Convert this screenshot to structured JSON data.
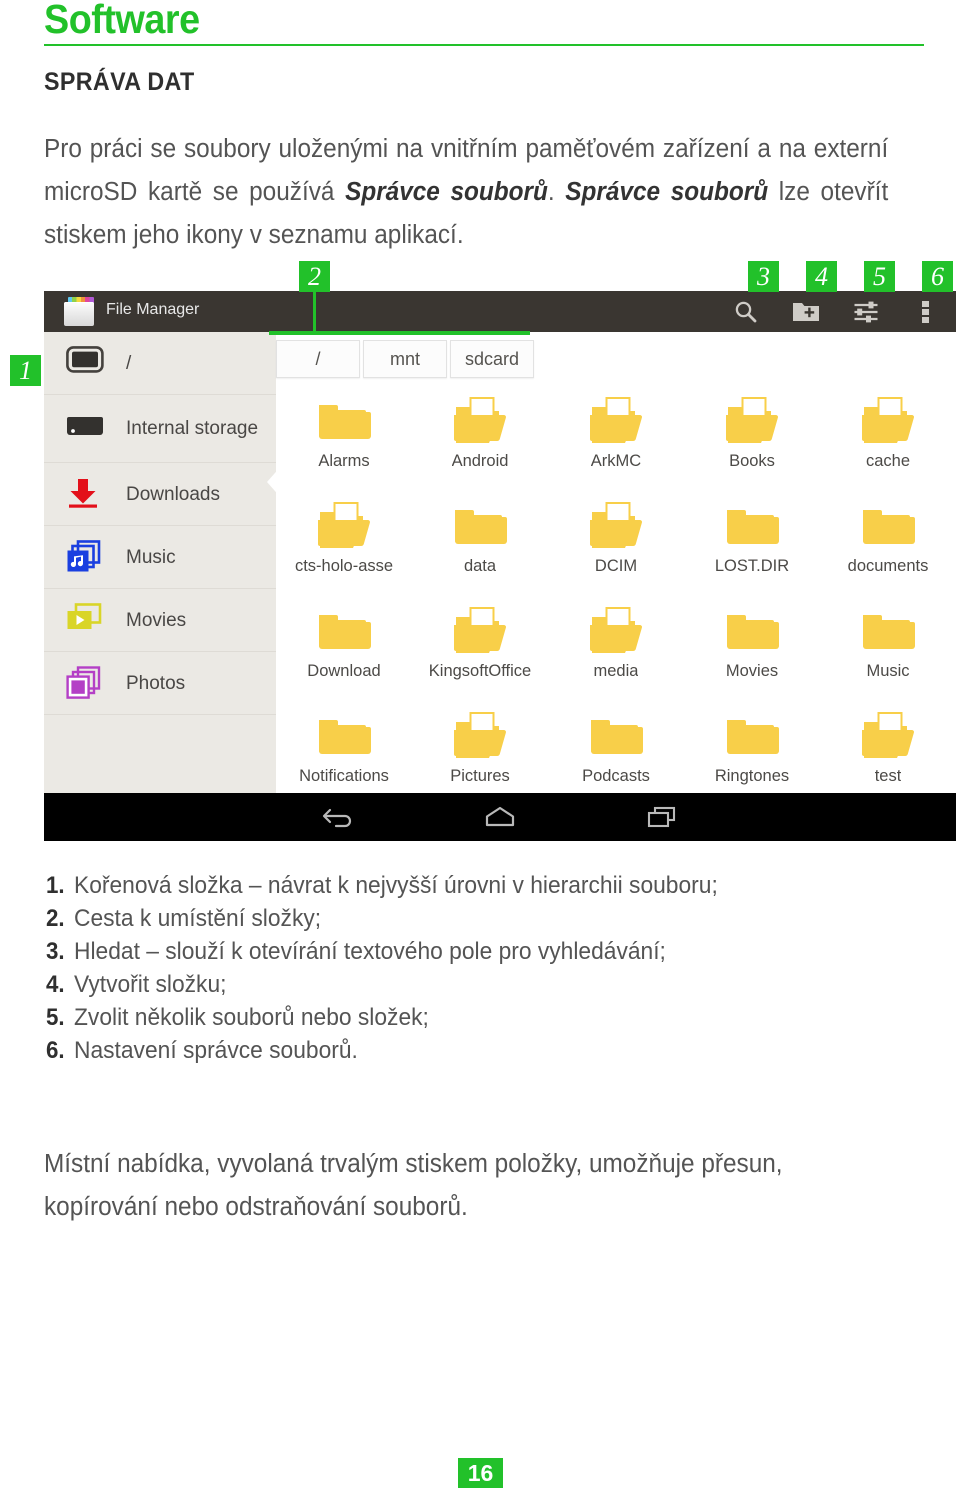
{
  "page": {
    "heading": "Software",
    "section_title": "SPRÁVA DAT",
    "intro_part1": "Pro práci se soubory uloženými na vnitřním paměťovém zařízení a na externí microSD kartě se používá ",
    "intro_italic1": "Správce souborů",
    "intro_part2": ". ",
    "intro_italic2": "Správce souborů",
    "intro_part3": " lze otevřít stiskem jeho ikony v seznamu aplikací.",
    "closing_paragraph": "Místní nabídka, vyvolaná trvalým stiskem položky, umožňuje přesun, kopírování nebo odstraňování souborů.",
    "page_number": "16",
    "accent_color": "#22c12a",
    "body_text_color": "#545454"
  },
  "screenshot": {
    "app_bar": {
      "title": "File Manager",
      "app_icon": "file-manager-folder-icon",
      "background": "#3a3631",
      "actions": [
        {
          "name": "search",
          "icon": "search-icon",
          "badge": "3"
        },
        {
          "name": "new-folder",
          "icon": "new-folder-icon",
          "badge": "4"
        },
        {
          "name": "select-multiple",
          "icon": "sliders-icon",
          "badge": "5"
        },
        {
          "name": "overflow-menu",
          "icon": "more-vertical-icon",
          "badge": "6"
        }
      ]
    },
    "sidebar": {
      "background": "#ebe9e4",
      "items": [
        {
          "label": "/",
          "icon": "device-icon",
          "icon_color": "#33312e"
        },
        {
          "label": "Internal storage",
          "icon": "hard-drive-icon",
          "icon_color": "#33312e"
        },
        {
          "label": "Downloads",
          "icon": "download-arrow-icon",
          "icon_color": "#e3101a"
        },
        {
          "label": "Music",
          "icon": "music-note-icon",
          "icon_color": "#1a3fe0"
        },
        {
          "label": "Movies",
          "icon": "play-video-icon",
          "icon_color": "#d9d528"
        },
        {
          "label": "Photos",
          "icon": "photos-stack-icon",
          "icon_color": "#b43fc6"
        }
      ]
    },
    "breadcrumb": {
      "crumbs": [
        "/",
        "mnt",
        "sdcard"
      ]
    },
    "files": [
      {
        "label": "Alarms",
        "icon": "folder-empty-icon"
      },
      {
        "label": "Android",
        "icon": "folder-with-file-icon"
      },
      {
        "label": "ArkMC",
        "icon": "folder-with-file-icon"
      },
      {
        "label": "Books",
        "icon": "folder-with-file-icon"
      },
      {
        "label": "cache",
        "icon": "folder-with-file-icon"
      },
      {
        "label": "cts-holo-asse",
        "icon": "folder-with-file-icon"
      },
      {
        "label": "data",
        "icon": "folder-empty-icon"
      },
      {
        "label": "DCIM",
        "icon": "folder-with-file-icon"
      },
      {
        "label": "LOST.DIR",
        "icon": "folder-empty-icon"
      },
      {
        "label": "documents",
        "icon": "folder-empty-icon"
      },
      {
        "label": "Download",
        "icon": "folder-empty-icon"
      },
      {
        "label": "KingsoftOffice",
        "icon": "folder-with-file-icon"
      },
      {
        "label": "media",
        "icon": "folder-with-file-icon"
      },
      {
        "label": "Movies",
        "icon": "folder-empty-icon"
      },
      {
        "label": "Music",
        "icon": "folder-empty-icon"
      },
      {
        "label": "Notifications",
        "icon": "folder-empty-icon"
      },
      {
        "label": "Pictures",
        "icon": "folder-with-file-icon"
      },
      {
        "label": "Podcasts",
        "icon": "folder-empty-icon"
      },
      {
        "label": "Ringtones",
        "icon": "folder-empty-icon"
      },
      {
        "label": "test",
        "icon": "folder-with-file-icon"
      }
    ],
    "nav_bar": {
      "background": "#000000",
      "buttons": [
        {
          "name": "back",
          "icon": "back-arrow-icon"
        },
        {
          "name": "home",
          "icon": "home-pentagon-icon"
        },
        {
          "name": "recents",
          "icon": "recents-stack-icon"
        }
      ]
    }
  },
  "callouts": {
    "badges": [
      "1",
      "2",
      "3",
      "4",
      "5",
      "6"
    ]
  },
  "features": [
    {
      "num": "1.",
      "text": "Kořenová složka – návrat k nejvyšší úrovni v hierarchii souboru;"
    },
    {
      "num": "2.",
      "text": "Cesta k umístění složky;"
    },
    {
      "num": "3.",
      "text": "Hledat – slouží k otevírání textového pole pro vyhledávání;"
    },
    {
      "num": "4.",
      "text": "Vytvořit složku;"
    },
    {
      "num": "5.",
      "text": "Zvolit několik souborů nebo složek;"
    },
    {
      "num": "6.",
      "text": "Nastavení správce souborů."
    }
  ]
}
